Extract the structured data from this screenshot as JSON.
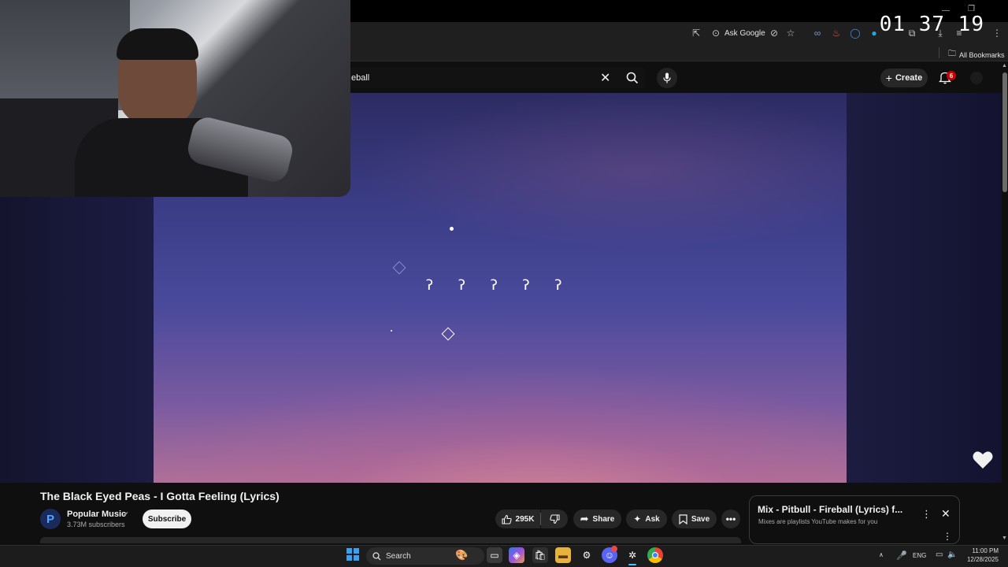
{
  "browser": {
    "toolbar": {
      "ask_google_label": "Ask Google"
    },
    "bookmarks": {
      "all_bookmarks_label": "All Bookmarks"
    }
  },
  "clock_overlay": "01 37 19",
  "youtube": {
    "search_query": "eball",
    "create_label": "Create",
    "notifications_count": "6"
  },
  "player": {
    "lyric_glyphs": [
      "ʔ",
      "ʔ",
      "ʔ",
      "ʔ",
      "ʔ"
    ]
  },
  "video": {
    "title": "The Black Eyed Peas - I Gotta Feeling (Lyrics)",
    "channel_name": "Popular Music",
    "channel_initial": "P",
    "subscribers": "3.73M subscribers",
    "subscribe_label": "Subscribe",
    "likes": "295K",
    "share_label": "Share",
    "ask_label": "Ask",
    "save_label": "Save"
  },
  "mix": {
    "title": "Mix - Pitbull - Fireball (Lyrics) f...",
    "subtitle": "Mixes are playlists YouTube makes for you"
  },
  "taskbar": {
    "search_label": "Search",
    "language": "ENG",
    "time": "11:00 PM",
    "date": "12/28/2025"
  },
  "colors": {
    "accent_red": "#ff0000",
    "subscribe_bg": "#f1f1f1",
    "brand_blue": "#4fa6ff"
  }
}
